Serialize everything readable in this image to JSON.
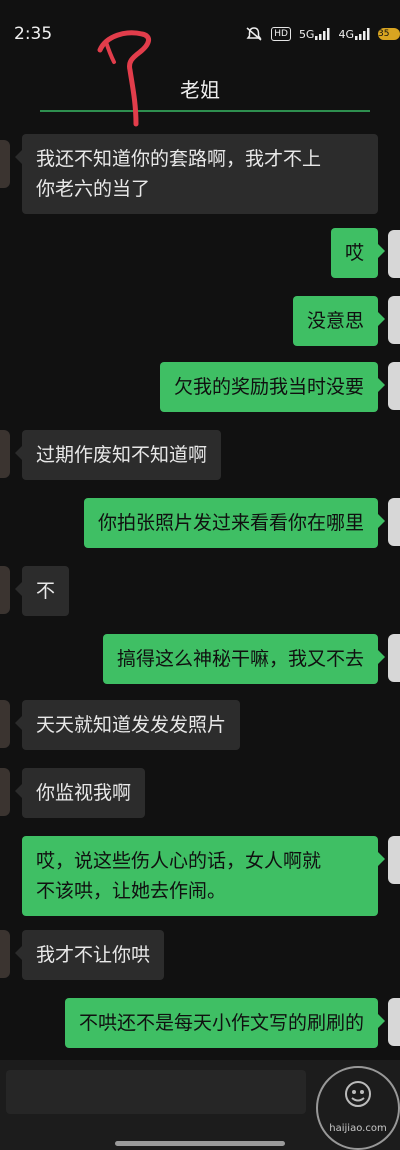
{
  "status": {
    "time": "2:35",
    "icons": [
      "bell-muted-icon",
      "hd-icon",
      "signal-5g-icon",
      "signal-4g-icon",
      "battery-icon"
    ],
    "hd_label": "HD",
    "signal_5g": "5G",
    "signal_4g": "4G",
    "battery_label": "35"
  },
  "header": {
    "title": "老姐"
  },
  "colors": {
    "background": "#111111",
    "bubble_left": "#2c2c2c",
    "bubble_right": "#3fbf64",
    "scribble": "#e23d4b"
  },
  "messages": [
    {
      "side": "left",
      "text": "我还不知道你的套路啊，我才不上\n你老六的当了"
    },
    {
      "side": "right",
      "text": "哎"
    },
    {
      "side": "right",
      "text": "没意思"
    },
    {
      "side": "right",
      "text": "欠我的奖励我当时没要"
    },
    {
      "side": "left",
      "text": "过期作废知不知道啊"
    },
    {
      "side": "right",
      "text": "你拍张照片发过来看看你在哪里"
    },
    {
      "side": "left",
      "text": "不"
    },
    {
      "side": "right",
      "text": "搞得这么神秘干嘛，我又不去"
    },
    {
      "side": "left",
      "text": "天天就知道发发发照片"
    },
    {
      "side": "left",
      "text": "你监视我啊"
    },
    {
      "side": "right",
      "text": "哎，说这些伤人心的话，女人啊就\n不该哄，让她去作闹。"
    },
    {
      "side": "left",
      "text": "我才不让你哄"
    },
    {
      "side": "right",
      "text": "不哄还不是每天小作文写的刷刷的"
    }
  ],
  "watermark": {
    "text": "haijiao.com"
  }
}
